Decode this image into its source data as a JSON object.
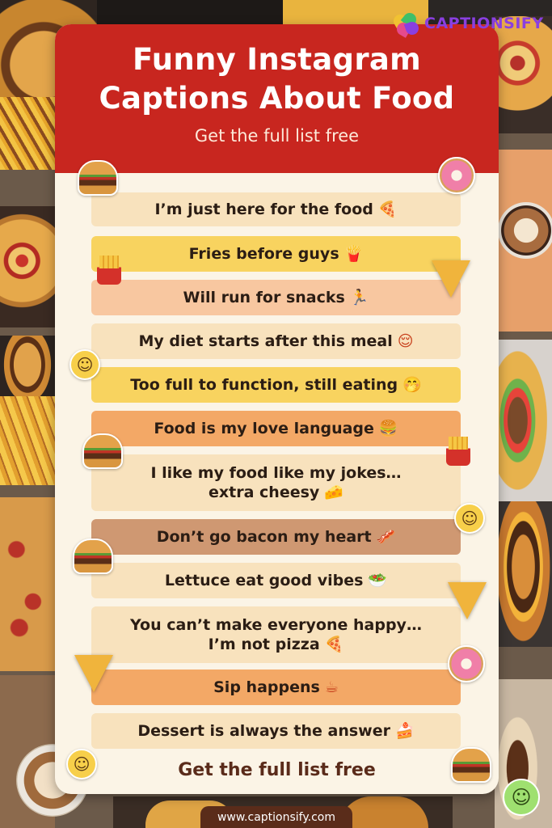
{
  "brand": {
    "name": "CAPTIONSIFY",
    "url": "www.captionsify.com"
  },
  "header": {
    "title_line1": "Funny Instagram",
    "title_line2": "Captions About Food",
    "subtitle": "Get the full list free"
  },
  "captions": [
    {
      "line1": "I’m just here for the food",
      "line2": "",
      "emoji": "🍕"
    },
    {
      "line1": "Fries before guys",
      "line2": "",
      "emoji": "🍟"
    },
    {
      "line1": "Will run for snacks",
      "line2": "",
      "emoji": "🏃"
    },
    {
      "line1": "My diet starts after this meal",
      "line2": "",
      "emoji": "😌"
    },
    {
      "line1": "Too full to function, still eating",
      "line2": "",
      "emoji": "🤭"
    },
    {
      "line1": "Food is my love language",
      "line2": "",
      "emoji": "🍔"
    },
    {
      "line1": "I like my food like my jokes…",
      "line2": "extra cheesy",
      "emoji": "🧀"
    },
    {
      "line1": "Don’t go bacon my heart",
      "line2": "",
      "emoji": "🥓"
    },
    {
      "line1": "Lettuce eat good vibes",
      "line2": "",
      "emoji": "🥗"
    },
    {
      "line1": "You can’t make everyone happy…",
      "line2": "I’m not pizza",
      "emoji": "🍕"
    },
    {
      "line1": "Sip happens",
      "line2": "",
      "emoji": "☕"
    },
    {
      "line1": "Dessert is always the answer",
      "line2": "",
      "emoji": "🍰"
    }
  ],
  "footer_cta": "Get the full list free",
  "colors": {
    "header_red": "#c8261f",
    "card_bg": "#fbf4e6",
    "row_cream": "#f8e2bd",
    "row_yellow": "#f8d35f",
    "row_peach": "#f8c7a0",
    "row_orange": "#f3a866",
    "row_brown": "#cf9872",
    "brand_purple": "#8a3fe0"
  }
}
